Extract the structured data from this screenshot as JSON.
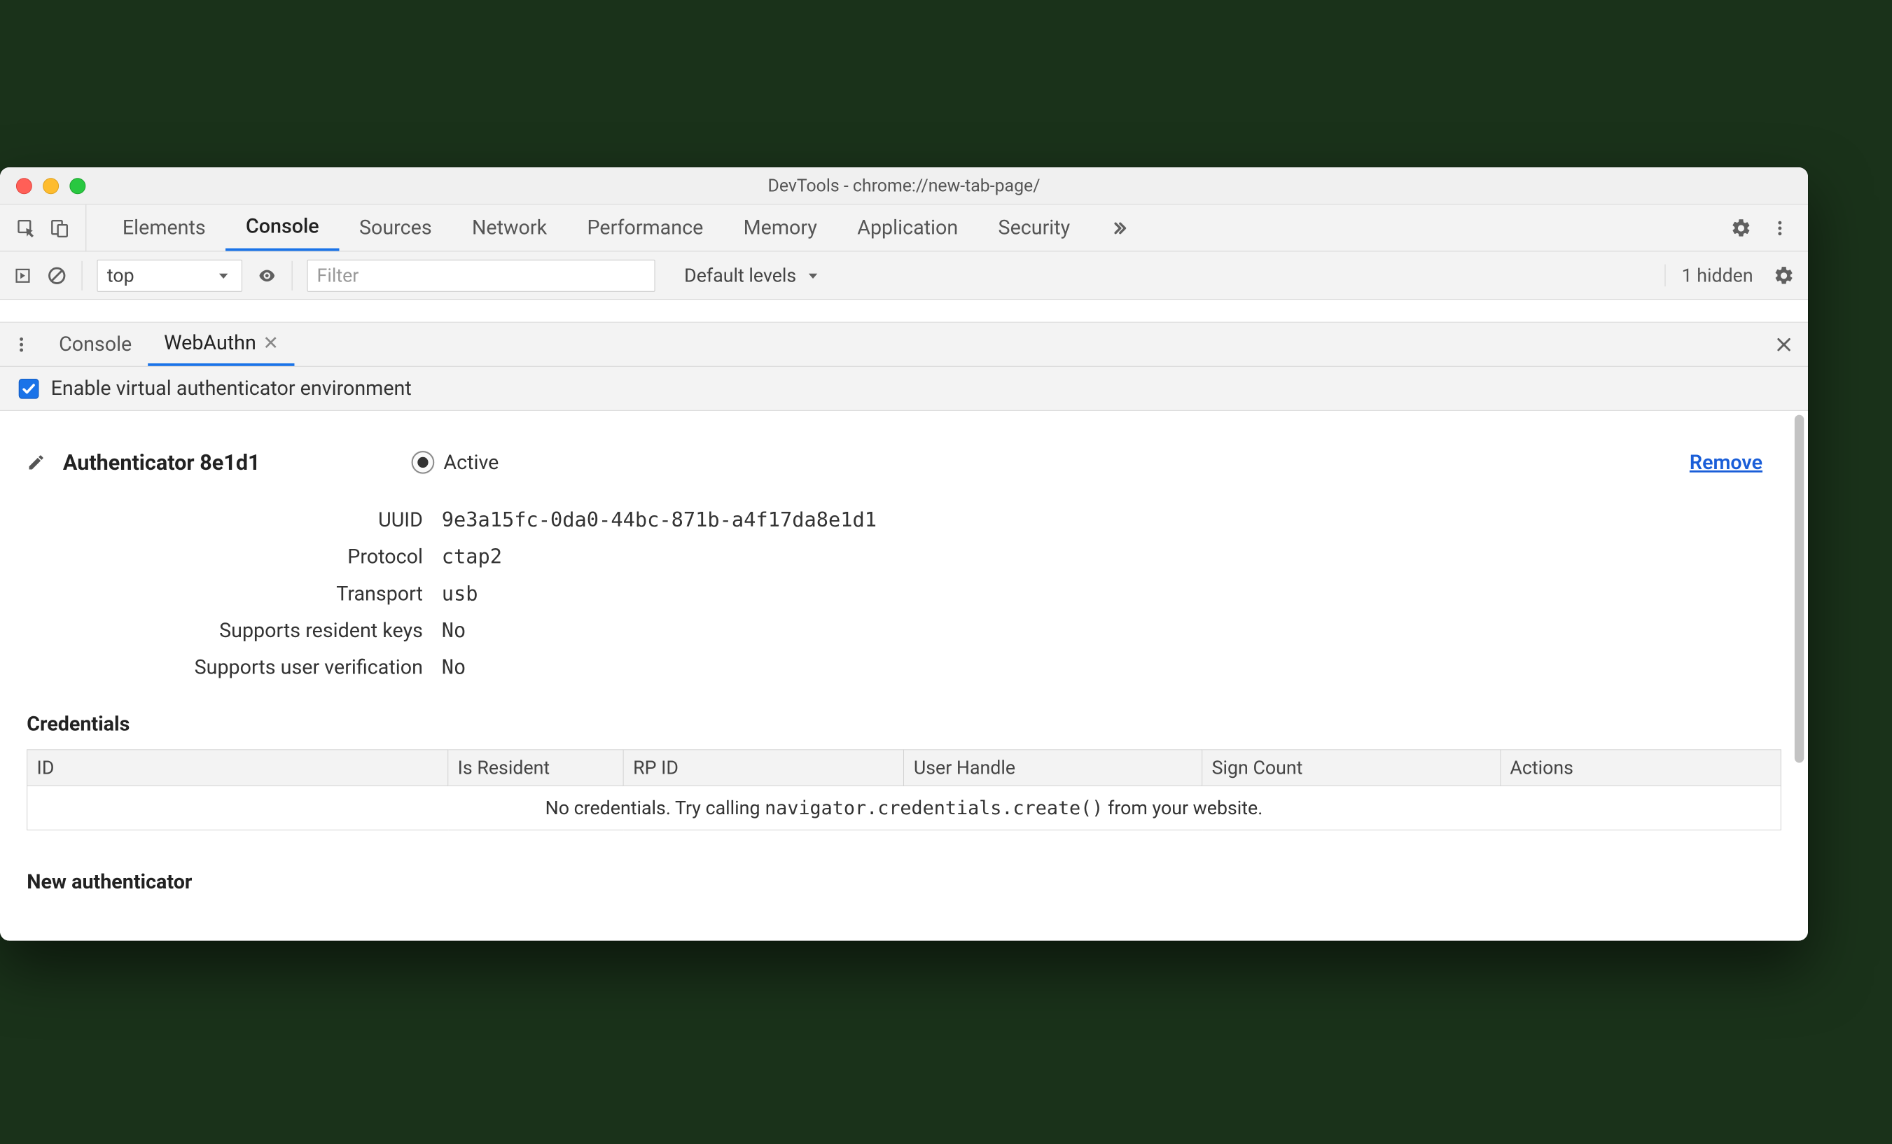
{
  "window": {
    "title": "DevTools - chrome://new-tab-page/"
  },
  "topTabs": {
    "items": [
      "Elements",
      "Console",
      "Sources",
      "Network",
      "Performance",
      "Memory",
      "Application",
      "Security"
    ],
    "activeIndex": 1
  },
  "consoleToolbar": {
    "context": "top",
    "filterPlaceholder": "Filter",
    "levels": "Default levels",
    "hiddenCount": "1 hidden"
  },
  "drawer": {
    "tabs": [
      {
        "label": "Console",
        "closable": false
      },
      {
        "label": "WebAuthn",
        "closable": true
      }
    ],
    "activeIndex": 1
  },
  "enableCheckbox": {
    "label": "Enable virtual authenticator environment",
    "checked": true
  },
  "authenticator": {
    "titlePrefix": "Authenticator",
    "shortId": "8e1d1",
    "activeLabel": "Active",
    "removeLabel": "Remove",
    "fields": {
      "uuidLabel": "UUID",
      "uuid": "9e3a15fc-0da0-44bc-871b-a4f17da8e1d1",
      "protocolLabel": "Protocol",
      "protocol": "ctap2",
      "transportLabel": "Transport",
      "transport": "usb",
      "residentKeysLabel": "Supports resident keys",
      "residentKeys": "No",
      "userVerificationLabel": "Supports user verification",
      "userVerification": "No"
    }
  },
  "credentials": {
    "sectionTitle": "Credentials",
    "columns": [
      "ID",
      "Is Resident",
      "RP ID",
      "User Handle",
      "Sign Count",
      "Actions"
    ],
    "emptyPrefix": "No credentials. Try calling ",
    "emptyCode": "navigator.credentials.create()",
    "emptySuffix": " from your website."
  },
  "newAuthenticator": {
    "title": "New authenticator"
  }
}
